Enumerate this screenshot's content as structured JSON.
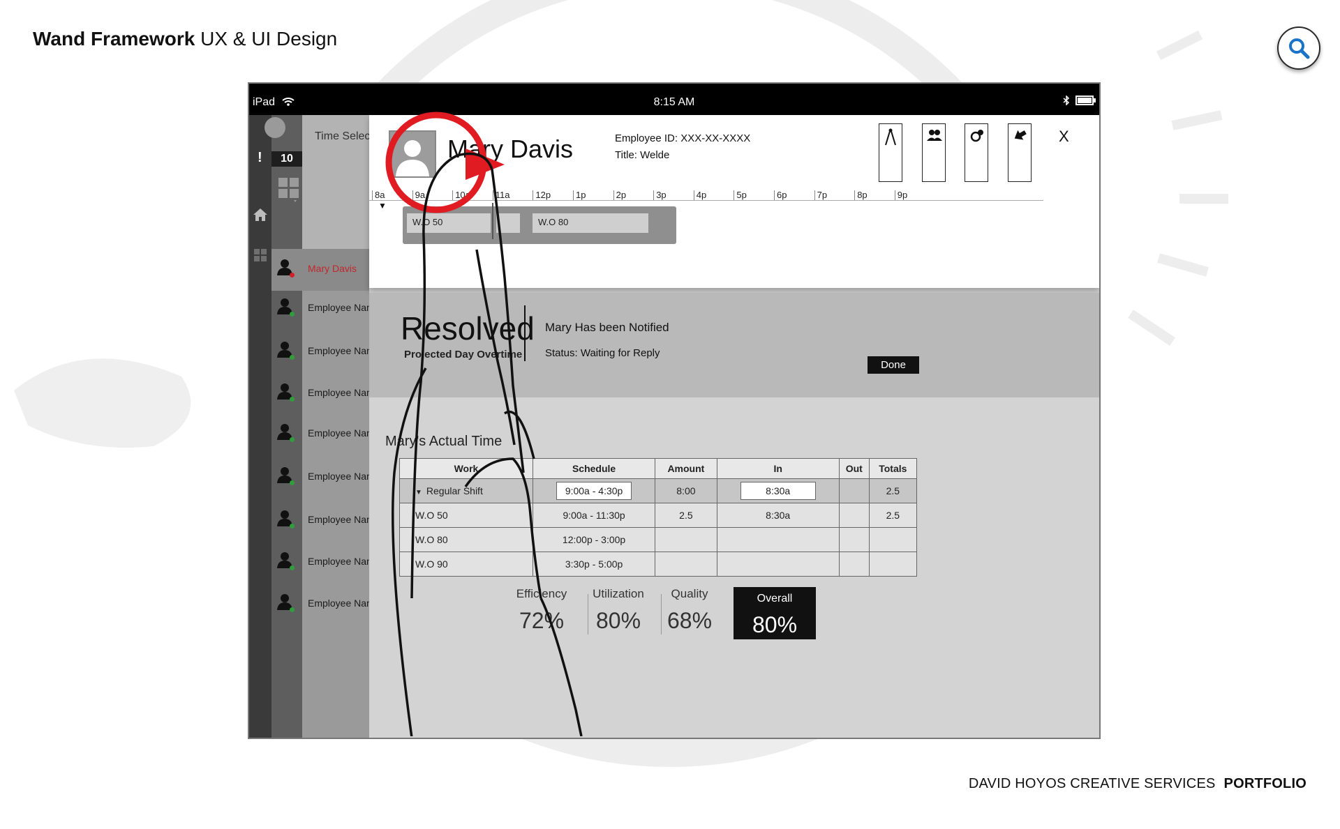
{
  "page": {
    "title_bold": "Wand Framework",
    "title_rest": " UX & UI Design",
    "footer_left": "DAVID HOYOS CREATIVE SERVICES",
    "footer_right": "PORTFOLIO"
  },
  "icons": {
    "search": "search-icon"
  },
  "status_bar": {
    "carrier": "iPad",
    "time": "8:15 AM"
  },
  "sidebar": {
    "badge": "10"
  },
  "list": {
    "header": "Time Select",
    "employees": [
      {
        "name": "Mary Davis",
        "status_color": "#d0202a"
      },
      {
        "name": "Employee Name",
        "status_color": "#2f9e3a"
      },
      {
        "name": "Employee Name",
        "status_color": "#2f9e3a"
      },
      {
        "name": "Employee Name",
        "status_color": "#2f9e3a"
      },
      {
        "name": "Employee Name",
        "status_color": "#2f9e3a"
      },
      {
        "name": "Employee Name",
        "status_color": "#2f9e3a"
      },
      {
        "name": "Employee Name",
        "status_color": "#2f9e3a"
      },
      {
        "name": "Employee Name",
        "status_color": "#2f9e3a"
      },
      {
        "name": "Employee Name",
        "status_color": "#2f9e3a"
      }
    ]
  },
  "employee": {
    "name": "Mary Davis",
    "id": "Employee ID: XXX-XX-XXXX",
    "title": "Title: Welde",
    "close": "X"
  },
  "timeline": {
    "hours": [
      "8a",
      "9a",
      "10a",
      "11a",
      "12p",
      "1p",
      "2p",
      "3p",
      "4p",
      "5p",
      "6p",
      "7p",
      "8p",
      "9p"
    ],
    "work_orders": [
      "W.O 50",
      "W.O 80"
    ]
  },
  "resolved": {
    "title": "Resolved",
    "subtitle": "Projected Day Overtime",
    "notified": "Mary Has been Notified",
    "status": "Status: Waiting for Reply",
    "done": "Done"
  },
  "actual_time": {
    "title": "Mary's Actual Time",
    "columns": [
      "Work",
      "Schedule",
      "Amount",
      "In",
      "Out",
      "Totals"
    ],
    "rows": [
      {
        "work": "Regular Shift",
        "schedule": "9:00a - 4:30p",
        "amount": "8:00",
        "in": "8:30a",
        "out": "",
        "totals": "2.5"
      },
      {
        "work": "W.O 50",
        "schedule": "9:00a - 11:30p",
        "amount": "2.5",
        "in": "8:30a",
        "out": "",
        "totals": "2.5"
      },
      {
        "work": "W.O 80",
        "schedule": "12:00p - 3:00p",
        "amount": "",
        "in": "",
        "out": "",
        "totals": ""
      },
      {
        "work": "W.O 90",
        "schedule": "3:30p - 5:00p",
        "amount": "",
        "in": "",
        "out": "",
        "totals": ""
      }
    ]
  },
  "metrics": [
    {
      "label": "Efficiency",
      "value": "72%"
    },
    {
      "label": "Utilization",
      "value": "80%"
    },
    {
      "label": "Quality",
      "value": "68%"
    }
  ],
  "overall": {
    "label": "Overall",
    "value": "80%"
  },
  "colors": {
    "accent_red": "#e01b22",
    "status_green": "#2f9e3a"
  }
}
